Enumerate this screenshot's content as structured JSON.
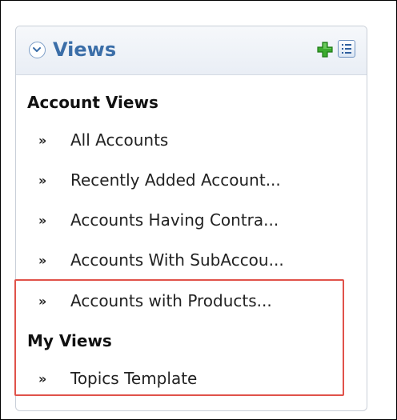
{
  "panel": {
    "title": "Views",
    "icons": {
      "collapse": "chevron-down-circle-icon",
      "add": "green-plus-icon",
      "manage": "list-icon"
    },
    "colors": {
      "title": "#3b6ea8",
      "add_icon": "#3cab2f",
      "highlight": "#e0524a"
    }
  },
  "sections": [
    {
      "title": "Account Views",
      "items": [
        {
          "icon": "double-chevron-right-icon",
          "label": "All Accounts"
        },
        {
          "icon": "double-chevron-right-icon",
          "label": "Recently Added Account..."
        },
        {
          "icon": "double-chevron-right-icon",
          "label": "Accounts Having Contra..."
        },
        {
          "icon": "double-chevron-right-icon",
          "label": "Accounts With SubAccou..."
        },
        {
          "icon": "double-chevron-right-icon",
          "label": "Accounts with Products..."
        }
      ]
    },
    {
      "title": "My Views",
      "items": [
        {
          "icon": "double-chevron-right-icon",
          "label": "Topics Template"
        }
      ]
    }
  ],
  "chevron_glyph": "»"
}
